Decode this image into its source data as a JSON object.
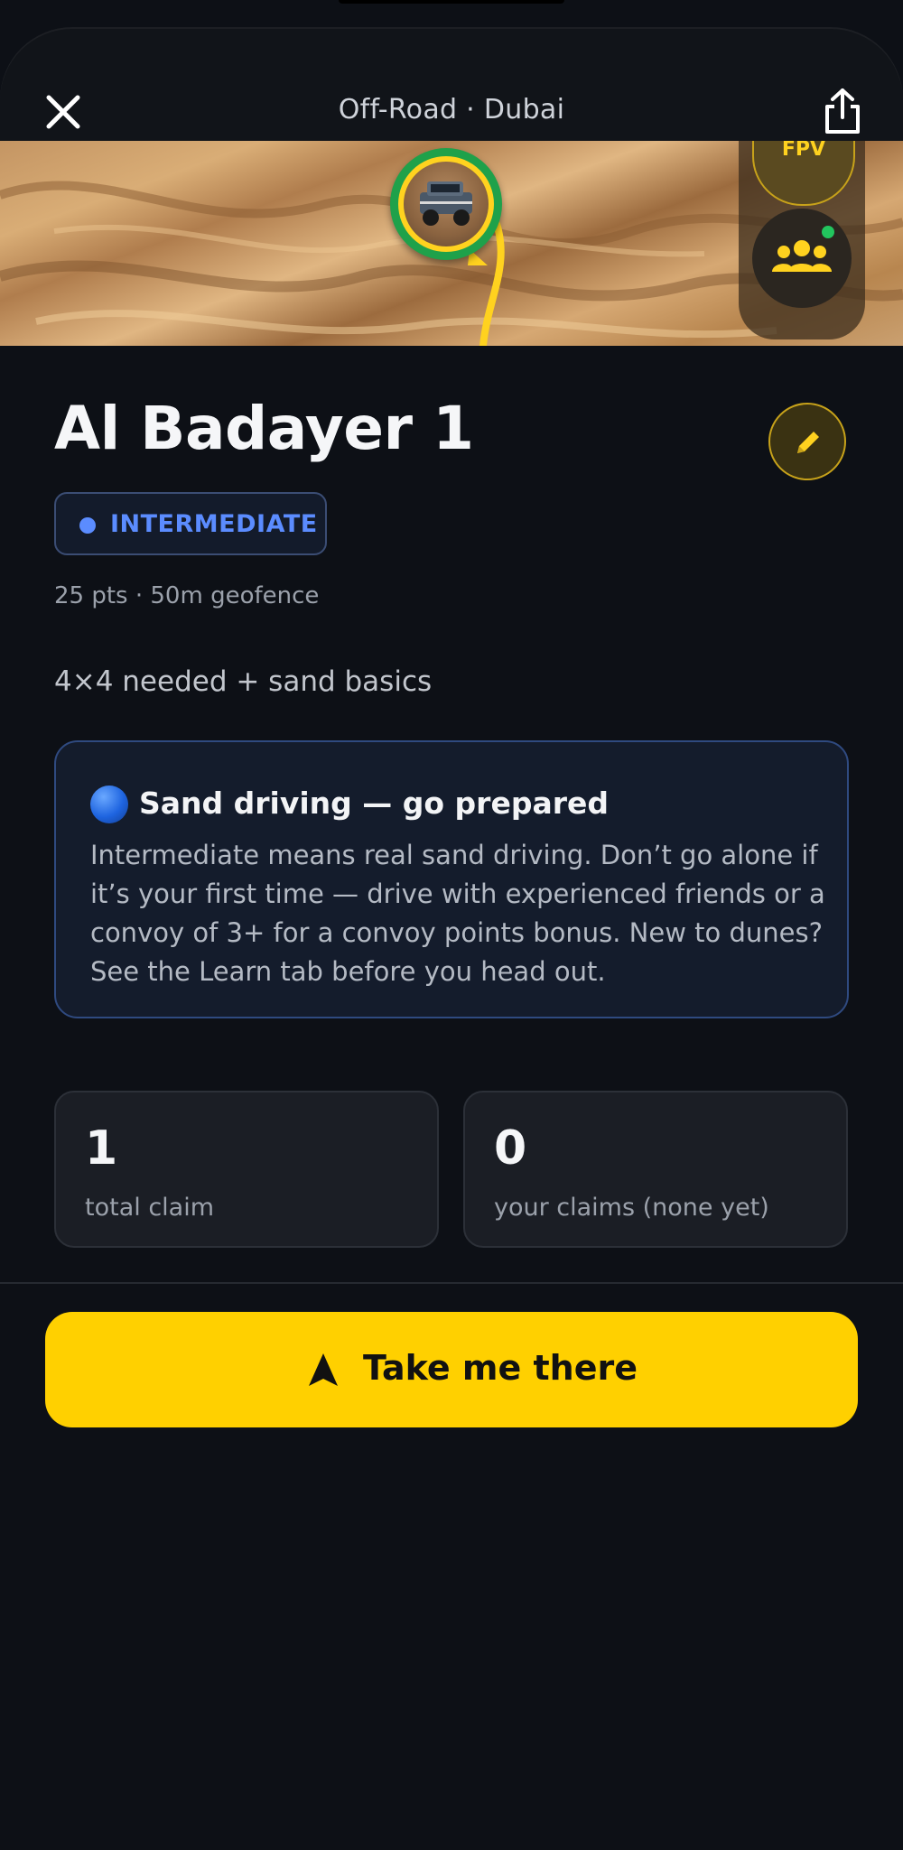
{
  "header": {
    "title": "Off-Road · Dubai",
    "close_icon": "close-icon",
    "share_icon": "share-icon"
  },
  "map": {
    "fpv_label": "FPV",
    "group_icon": "group-icon",
    "group_status_color": "#22c55e",
    "route_color": "#ffd21f"
  },
  "spot": {
    "name": "Al Badayer 1",
    "difficulty": "INTERMEDIATE",
    "difficulty_color": "#5b8cff",
    "meta": "25 pts · 50m geofence",
    "description": "4×4 needed + sand basics"
  },
  "info_card": {
    "title": "Sand driving — go prepared",
    "body": "Intermediate means real sand driving. Don’t go alone if it’s your first time — drive with experienced friends or a convoy of 3+ for a convoy points bonus. New to dunes? See the Learn tab before you head out."
  },
  "stats": [
    {
      "value": "1",
      "label": "total claim"
    },
    {
      "value": "0",
      "label": "your claims (none yet)"
    }
  ],
  "cta": {
    "label": "Take me there",
    "icon": "navigation-arrow-icon",
    "color": "#ffd000"
  }
}
